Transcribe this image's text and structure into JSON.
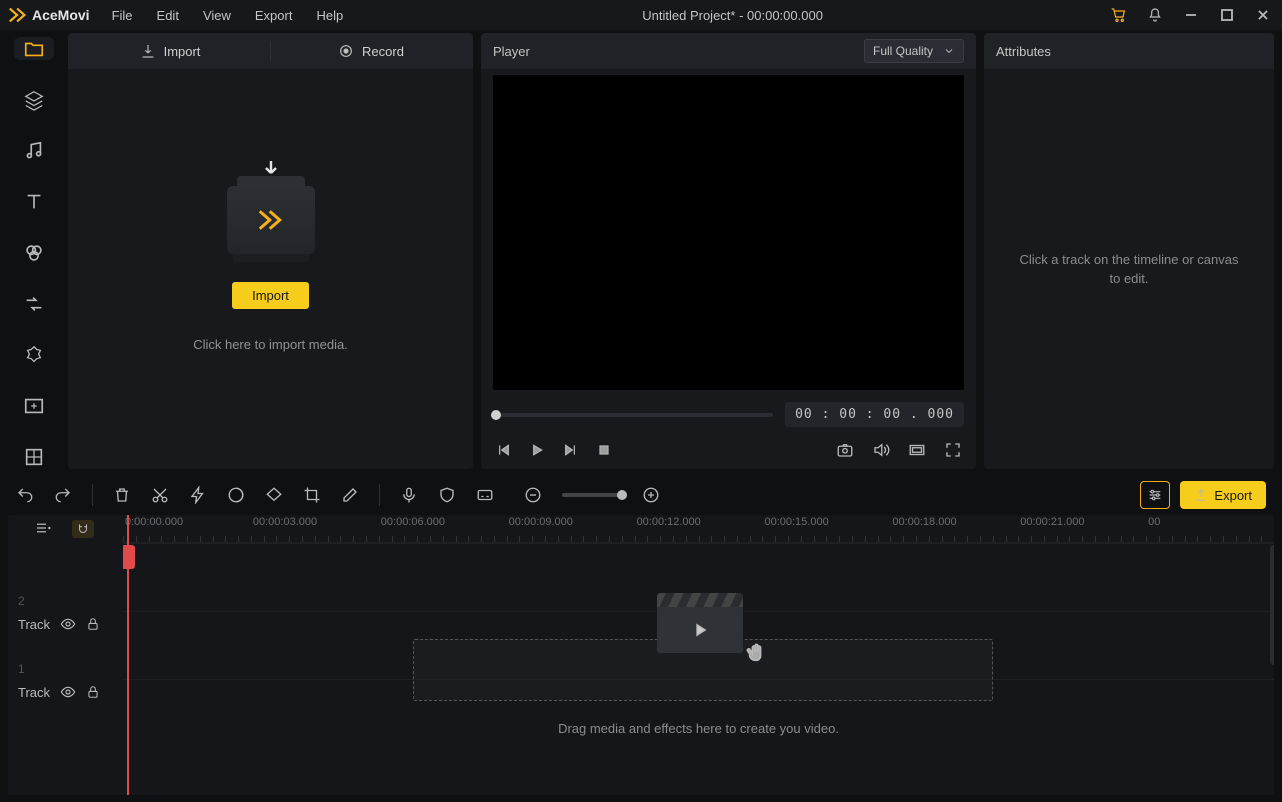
{
  "app": {
    "name": "AceMovi",
    "title": "Untitled Project* - 00:00:00.000"
  },
  "menu": {
    "file": "File",
    "edit": "Edit",
    "view": "View",
    "export": "Export",
    "help": "Help"
  },
  "media": {
    "import_tab": "Import",
    "record_tab": "Record",
    "import_button": "Import",
    "hint": "Click here to import media."
  },
  "player": {
    "label": "Player",
    "quality": "Full Quality",
    "timecode": "00 : 00 : 00 . 000"
  },
  "attributes": {
    "label": "Attributes",
    "hint": "Click a track on the timeline or canvas to edit."
  },
  "toolbar": {
    "export": "Export"
  },
  "timeline": {
    "ticks": [
      "0:00:00.000",
      "00:00:03.000",
      "00:00:06.000",
      "00:00:09.000",
      "00:00:12.000",
      "00:00:15.000",
      "00:00:18.000",
      "00:00:21.000",
      "00"
    ],
    "rows": [
      {
        "num": "",
        "label": ""
      },
      {
        "num": "2",
        "label": "Track"
      },
      {
        "num": "1",
        "label": "Track"
      }
    ],
    "drop_hint": "Drag media and effects here to create you video."
  }
}
